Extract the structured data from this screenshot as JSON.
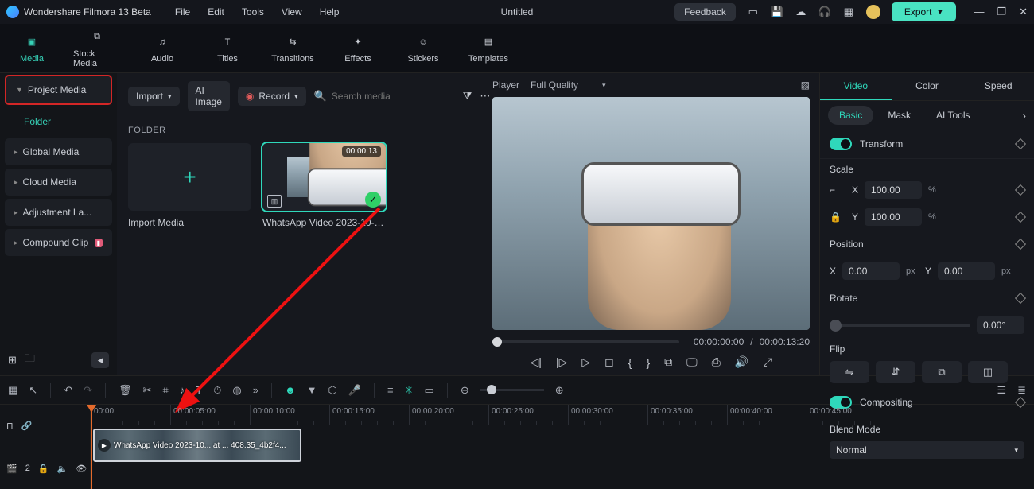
{
  "app_title": "Wondershare Filmora 13 Beta",
  "menus": [
    "File",
    "Edit",
    "Tools",
    "View",
    "Help"
  ],
  "document_title": "Untitled",
  "feedback_label": "Feedback",
  "export_label": "Export",
  "top_tabs": [
    {
      "label": "Media",
      "active": true
    },
    {
      "label": "Stock Media",
      "active": false
    },
    {
      "label": "Audio",
      "active": false
    },
    {
      "label": "Titles",
      "active": false
    },
    {
      "label": "Transitions",
      "active": false
    },
    {
      "label": "Effects",
      "active": false
    },
    {
      "label": "Stickers",
      "active": false
    },
    {
      "label": "Templates",
      "active": false
    }
  ],
  "sidebar": {
    "project_media": "Project Media",
    "folder_label": "Folder",
    "items": [
      "Global Media",
      "Cloud Media",
      "Adjustment La...",
      "Compound Clip"
    ]
  },
  "mediabar": {
    "import": "Import",
    "ai_image": "AI Image",
    "record": "Record",
    "search_placeholder": "Search media"
  },
  "folder_header": "FOLDER",
  "thumbs": {
    "import_label": "Import Media",
    "clip_label": "WhatsApp Video 2023-10-05...",
    "clip_duration": "00:00:13"
  },
  "preview": {
    "player_label": "Player",
    "quality": "Full Quality",
    "time_current": "00:00:00:00",
    "time_total": "00:00:13:20"
  },
  "right": {
    "tabs": [
      "Video",
      "Color",
      "Speed"
    ],
    "subtabs": [
      "Basic",
      "Mask",
      "AI Tools"
    ],
    "sections": {
      "transform": "Transform",
      "scale": "Scale",
      "position": "Position",
      "rotate": "Rotate",
      "flip": "Flip",
      "compositing": "Compositing",
      "blend_mode": "Blend Mode"
    },
    "values": {
      "scale_x": "100.00",
      "scale_y": "100.00",
      "pos_x": "0.00",
      "pos_x_unit": "px",
      "pos_y": "0.00",
      "pos_y_unit": "px",
      "rotate": "0.00°",
      "blend_mode": "Normal",
      "pct": "%"
    },
    "axis": {
      "x": "X",
      "y": "Y"
    }
  },
  "timeline": {
    "ticks": [
      "00:00",
      "00:00:05:00",
      "00:00:10:00",
      "00:00:15:00",
      "00:00:20:00",
      "00:00:25:00",
      "00:00:30:00",
      "00:00:35:00",
      "00:00:40:00",
      "00:00:45:00"
    ],
    "clip_label": "WhatsApp Video 2023-10... at ... 408.35_4b2f4...",
    "track_label": "2"
  }
}
